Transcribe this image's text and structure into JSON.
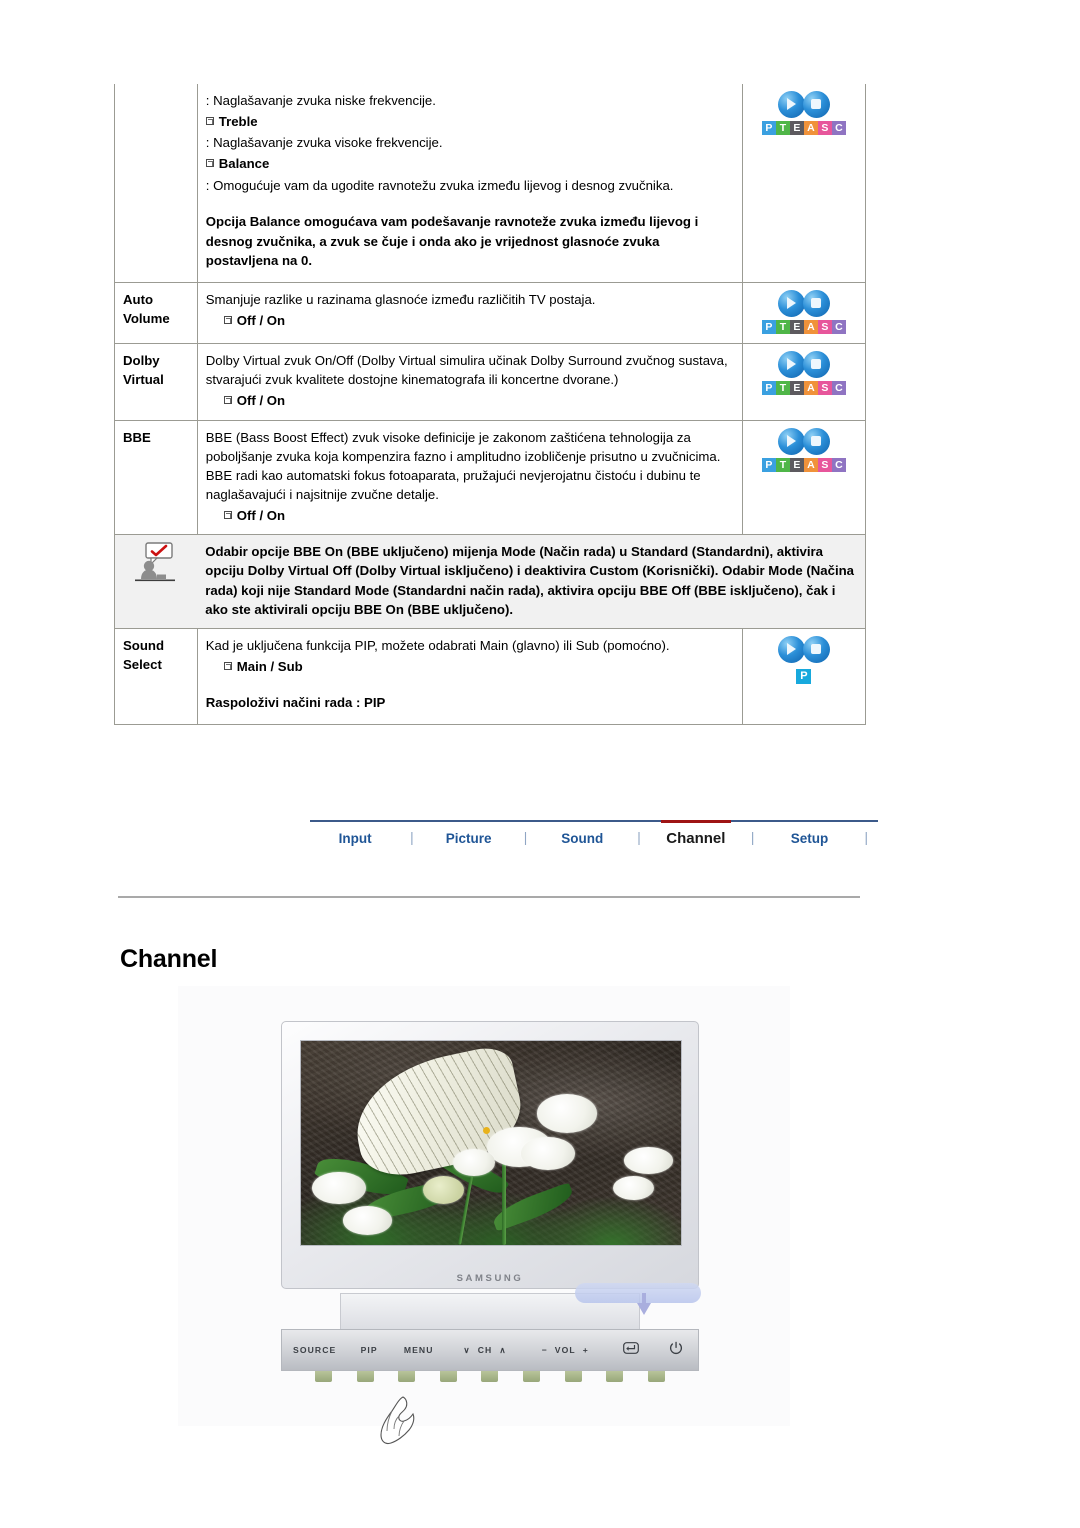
{
  "spec_table": {
    "rows": [
      {
        "label_lines": [],
        "desc_lines": [
          ": Naglašavanje zvuka niske frekvencije.",
          "Treble",
          ": Naglašavanje zvuka visoke frekvencije.",
          "Balance",
          ": Omogućuje vam da ugodite ravnotežu zvuka između lijevog i desnog zvučnika."
        ],
        "note_bold": "Opcija Balance omogućava vam podešavanje ravnoteže zvuka između lijevog i desnog zvučnika, a zvuk se čuje i onda ako je vrijednost glasnoće zvuka postavljena na 0.",
        "icon": "pteasc-icon"
      },
      {
        "label_lines": [
          "Auto",
          "Volume"
        ],
        "desc": "Smanjuje razlike u razinama glasnoće između različitih TV postaja.",
        "option": "Off / On",
        "icon": "pteasc-icon"
      },
      {
        "label_lines": [
          "Dolby",
          "Virtual"
        ],
        "desc": "Dolby Virtual zvuk On/Off (Dolby Virtual simulira učinak Dolby Surround zvučnog sustava, stvarajući zvuk kvalitete dostojne kinematografa ili koncertne dvorane.)",
        "option": "Off / On",
        "icon": "pteasc-icon"
      },
      {
        "label_lines": [
          "BBE"
        ],
        "desc": "BBE (Bass Boost Effect) zvuk visoke definicije je zakonom zaštićena tehnologija za poboljšanje zvuka koja kompenzira fazno i amplitudno izobličenje prisutno u zvučnicima. BBE radi kao automatski fokus fotoaparata, pružajući nevjerojatnu čistoću i dubinu te naglašavajući i najsitnije zvučne detalje.",
        "option": "Off / On",
        "icon": "pteasc-icon"
      },
      {
        "label_lines": [
          "Sound",
          "Select"
        ],
        "desc": "Kad je uključena funkcija PIP, možete odabrati Main (glavno) ili Sub (pomoćno).",
        "option": "Main / Sub",
        "extra_bold": "Raspoloživi načini rada : PIP",
        "icon": "pip-icon"
      }
    ],
    "note": {
      "icon": "person-speech-check-icon",
      "text": "Odabir opcije BBE On (BBE uključeno) mijenja Mode (Način rada) u Standard (Standardni), aktivira opciju Dolby Virtual Off (Dolby Virtual isključeno) i deaktivira Custom (Korisnički). Odabir Mode (Načina rada) koji nije Standard Mode (Standardni način rada), aktivira opciju BBE Off (BBE isključeno), čak i ako ste aktivirali opciju BBE On (BBE uključeno)."
    },
    "mode_badge_letters": [
      {
        "letter": "P",
        "color": "#3aa0e0"
      },
      {
        "letter": "T",
        "color": "#4fb648"
      },
      {
        "letter": "E",
        "color": "#5d5a5f"
      },
      {
        "letter": "A",
        "color": "#f0923a"
      },
      {
        "letter": "S",
        "color": "#e7569b"
      },
      {
        "letter": "C",
        "color": "#8f74c2"
      }
    ],
    "pip_badge_letter": "P"
  },
  "nav": {
    "tabs": [
      {
        "label": "Input",
        "active": false
      },
      {
        "label": "Picture",
        "active": false
      },
      {
        "label": "Sound",
        "active": false
      },
      {
        "label": "Channel",
        "active": true
      },
      {
        "label": "Setup",
        "active": false
      }
    ],
    "separator": "|",
    "active_color": "#9e1414",
    "link_color": "#1f5596"
  },
  "section": {
    "title": "Channel"
  },
  "figure": {
    "monitor_brand": "SAMSUNG",
    "controls": [
      "SOURCE",
      "PIP",
      "MENU",
      "CH",
      "VOL",
      "enter-icon",
      "power-icon"
    ],
    "control_labels": {
      "source": "SOURCE",
      "pip": "PIP",
      "menu": "MENU",
      "ch_down": "∨",
      "ch": "CH",
      "ch_up": "∧",
      "vol_minus": "−",
      "vol": "VOL",
      "vol_plus": "+",
      "enter": "↵",
      "power": "⏻"
    }
  }
}
